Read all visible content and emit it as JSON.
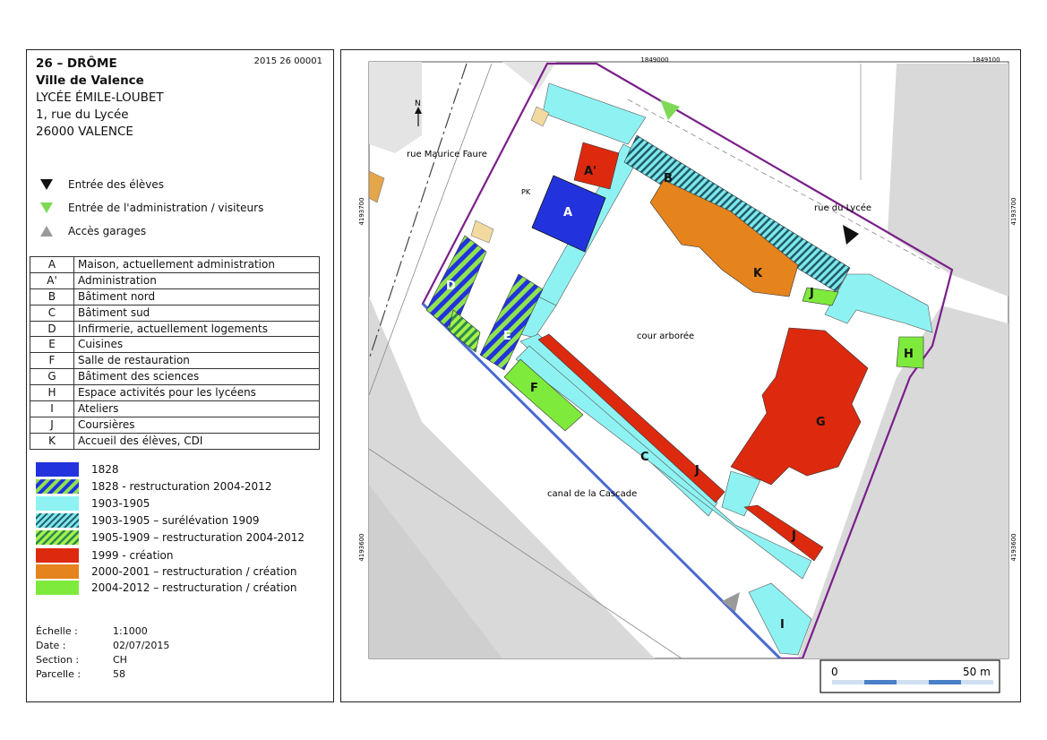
{
  "header": {
    "department": "26 – DRÔME",
    "city": "Ville de Valence",
    "school": "LYCÉE ÉMILE-LOUBET",
    "address": "1, rue du Lycée",
    "postcode": "26000 VALENCE",
    "code": "2015 26 00001"
  },
  "symbols": [
    {
      "label": "Entrée des élèves",
      "color": "#111111",
      "icon": "down-triangle-icon"
    },
    {
      "label": "Entrée de l'administration / visiteurs",
      "color": "#7ed957",
      "icon": "down-triangle-icon"
    },
    {
      "label": "Accès garages",
      "color": "#9a9a9a",
      "icon": "up-triangle-icon"
    }
  ],
  "buildings": [
    {
      "letter": "A",
      "name": "Maison, actuellement administration"
    },
    {
      "letter": "A'",
      "name": "Administration"
    },
    {
      "letter": "B",
      "name": "Bâtiment nord"
    },
    {
      "letter": "C",
      "name": "Bâtiment sud"
    },
    {
      "letter": "D",
      "name": "Infirmerie, actuellement logements"
    },
    {
      "letter": "E",
      "name": "Cuisines"
    },
    {
      "letter": "F",
      "name": "Salle de restauration"
    },
    {
      "letter": "G",
      "name": "Bâtiment des sciences"
    },
    {
      "letter": "H",
      "name": "Espace activités pour les lycéens"
    },
    {
      "letter": "I",
      "name": "Ateliers"
    },
    {
      "letter": "J",
      "name": "Coursières"
    },
    {
      "letter": "K",
      "name": "Accueil des élèves, CDI"
    }
  ],
  "legend": [
    {
      "label": "1828",
      "color": "#2233dd",
      "pattern": "solid"
    },
    {
      "label": "1828 - restructuration 2004-2012",
      "color": "#2233dd",
      "pattern": "stripe-green-blue"
    },
    {
      "label": "1903-1905",
      "color": "#8ff2f2",
      "pattern": "solid"
    },
    {
      "label": "1903-1905  – surélévation 1909",
      "color": "#5fc8c8",
      "pattern": "stripe-cyan-navy"
    },
    {
      "label": "1905-1909 – restructuration 2004-2012",
      "color": "#8fe34f",
      "pattern": "stripe-green-cyan"
    },
    {
      "label": "1999  - création",
      "color": "#dd2a0f",
      "pattern": "solid"
    },
    {
      "label": "2000-2001 – restructuration / création",
      "color": "#e5831c",
      "pattern": "solid"
    },
    {
      "label": "2004-2012 – restructuration / création",
      "color": "#7eea3c",
      "pattern": "solid"
    }
  ],
  "meta": [
    {
      "key": "Échelle :",
      "value": "1:1000"
    },
    {
      "key": "Date :",
      "value": "02/07/2015"
    },
    {
      "key": "Section :",
      "value": "CH"
    },
    {
      "key": "Parcelle :",
      "value": "58"
    }
  ],
  "map": {
    "coord_x1": "1849000",
    "coord_x2": "1849100",
    "coord_y1": "4193700",
    "coord_y2": "4193600",
    "street_1": "rue Maurice Faure",
    "street_2": "rue du Lycée",
    "canal": "canal de la Cascade",
    "courtyard": "cour arborée",
    "pk": "PK",
    "north": "N",
    "scale_start": "0",
    "scale_end": "50 m",
    "labels": {
      "A": "A",
      "A2": "A'",
      "B": "B",
      "C": "C",
      "D": "D",
      "E": "E",
      "F": "F",
      "G": "G",
      "H": "H",
      "I": "I",
      "J": "J",
      "K": "K"
    }
  }
}
